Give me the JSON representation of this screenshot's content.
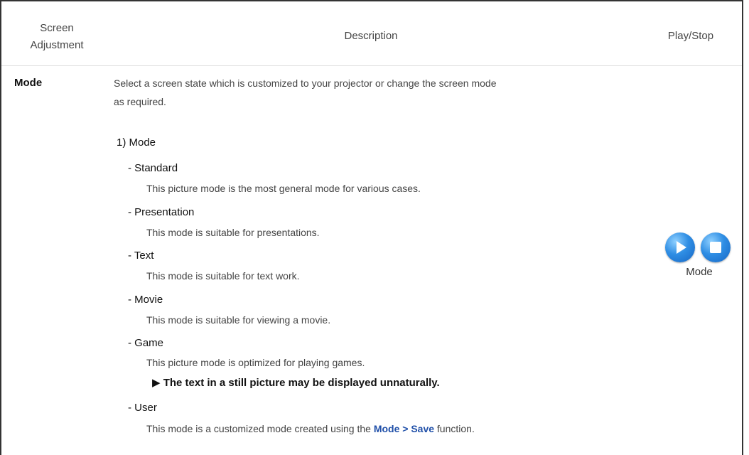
{
  "header": {
    "col1": "Screen\nAdjustment",
    "col1_line1": "Screen",
    "col1_line2": "Adjustment",
    "col2": "Description",
    "col3": "Play/Stop"
  },
  "row": {
    "label": "Mode",
    "intro_line1": "Select a screen state which is customized to your projector or change the screen mode",
    "intro_line2": "as required.",
    "section_title": "1) Mode",
    "modes": [
      {
        "title": "- Standard",
        "desc": "This picture mode is the most general mode for various cases."
      },
      {
        "title": "- Presentation",
        "desc": "This mode is suitable for presentations."
      },
      {
        "title": "- Text",
        "desc": "This mode is suitable for text work."
      },
      {
        "title": "- Movie",
        "desc": "This mode is suitable for viewing a movie."
      },
      {
        "title": "- Game",
        "desc": "This picture mode is optimized for playing games."
      },
      {
        "title": "- User",
        "desc_before": "This mode is a customized mode created using the ",
        "desc_link": "Mode > Save",
        "desc_after": " function."
      }
    ],
    "game_note": "▶ The text in a still picture may be displayed unnaturally."
  },
  "controls": {
    "play_icon": "play-icon",
    "stop_icon": "stop-icon",
    "label": "Mode"
  },
  "colors": {
    "link": "#1f4fa8",
    "button": "#2f8ee4"
  }
}
